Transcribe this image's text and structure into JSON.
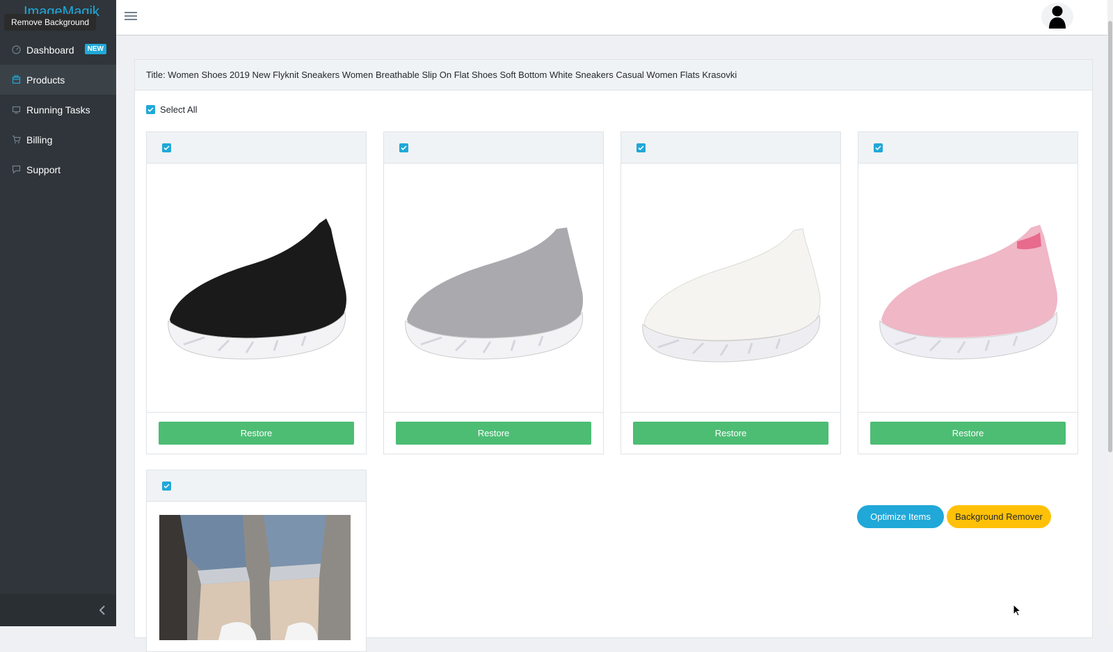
{
  "sidebar": {
    "brand": "ImageMagik",
    "tooltip": "Remove Background",
    "items": [
      {
        "label": "Dashboard",
        "icon": "speedometer-icon",
        "badge": "NEW",
        "active": false
      },
      {
        "label": "Products",
        "icon": "box-icon",
        "active": true
      },
      {
        "label": "Running Tasks",
        "icon": "monitor-icon",
        "active": false
      },
      {
        "label": "Billing",
        "icon": "cart-icon",
        "active": false
      },
      {
        "label": "Support",
        "icon": "chat-icon",
        "active": false
      }
    ],
    "collapse_icon": "chevron-left-icon"
  },
  "header": {
    "menu_icon": "hamburger-icon",
    "avatar_icon": "user-icon"
  },
  "card": {
    "title": "Title: Women Shoes 2019 New Flyknit Sneakers Women Breathable Slip On Flat Shoes Soft Bottom White Sneakers Casual Women Flats Krasovki",
    "select_all_label": "Select All",
    "select_all_checked": true,
    "items": [
      {
        "checked": true,
        "image": "black sneaker",
        "restore_label": "Restore"
      },
      {
        "checked": true,
        "image": "grey sneaker",
        "restore_label": "Restore"
      },
      {
        "checked": true,
        "image": "white sneaker",
        "restore_label": "Restore"
      },
      {
        "checked": true,
        "image": "pink sneaker",
        "restore_label": "Restore"
      },
      {
        "checked": true,
        "image": "photo of feet in jeans"
      }
    ],
    "optimize_label": "Optimize Items",
    "bg_remover_label": "Background Remover"
  },
  "colors": {
    "primary": "#20a8d8",
    "success": "#4dbd74",
    "warning": "#ffc107",
    "sidebar_bg": "#2f353a"
  }
}
